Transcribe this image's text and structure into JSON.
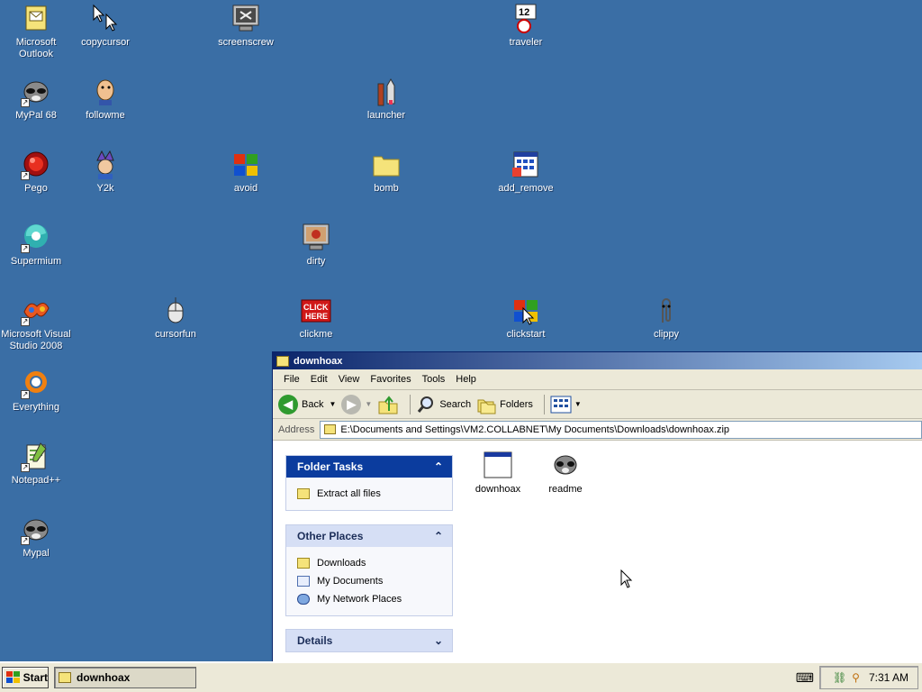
{
  "desktop": {
    "icons": [
      {
        "label": "Microsoft Outlook",
        "icon": "outlook-icon"
      },
      {
        "label": "copycursor",
        "icon": "cursor-icon"
      },
      {
        "label": "screenscrew",
        "icon": "monitor-icon"
      },
      {
        "label": "traveler",
        "icon": "traveler-icon"
      },
      {
        "label": "MyPal 68",
        "icon": "raccoon-icon"
      },
      {
        "label": "followme",
        "icon": "face-icon"
      },
      {
        "label": "launcher",
        "icon": "rocket-icon"
      },
      {
        "label": "Pego",
        "icon": "red-ball-icon"
      },
      {
        "label": "Y2k",
        "icon": "jester-icon"
      },
      {
        "label": "avoid",
        "icon": "windows-flag-icon"
      },
      {
        "label": "bomb",
        "icon": "folder-icon"
      },
      {
        "label": "add_remove",
        "icon": "calendar-icon"
      },
      {
        "label": "Supermium",
        "icon": "supermium-icon"
      },
      {
        "label": "dirty",
        "icon": "monitor-icon"
      },
      {
        "label": "Microsoft Visual Studio 2008",
        "icon": "visual-studio-icon"
      },
      {
        "label": "cursorfun",
        "icon": "mouse-icon"
      },
      {
        "label": "clickme",
        "icon": "click-here-icon"
      },
      {
        "label": "clickstart",
        "icon": "windows-flag-icon"
      },
      {
        "label": "clippy",
        "icon": "paperclip-icon"
      },
      {
        "label": "Everything",
        "icon": "everything-icon"
      },
      {
        "label": "Notepad++",
        "icon": "notepad-icon"
      },
      {
        "label": "Mypal",
        "icon": "raccoon-icon"
      }
    ]
  },
  "window": {
    "title": "downhoax",
    "menu": [
      "File",
      "Edit",
      "View",
      "Favorites",
      "Tools",
      "Help"
    ],
    "toolbar": {
      "back": "Back",
      "search": "Search",
      "folders": "Folders"
    },
    "address_label": "Address",
    "address_value": "E:\\Documents and Settings\\VM2.COLLABNET\\My Documents\\Downloads\\downhoax.zip",
    "folder_tasks": {
      "title": "Folder Tasks",
      "items": [
        "Extract all files"
      ]
    },
    "other_places": {
      "title": "Other Places",
      "items": [
        "Downloads",
        "My Documents",
        "My Network Places"
      ]
    },
    "details": {
      "title": "Details"
    },
    "files": [
      {
        "name": "downhoax",
        "icon": "window-app-icon"
      },
      {
        "name": "readme",
        "icon": "raccoon-icon"
      }
    ]
  },
  "taskbar": {
    "start_label": "Start",
    "task_label": "downhoax",
    "clock": "7:31 AM"
  }
}
